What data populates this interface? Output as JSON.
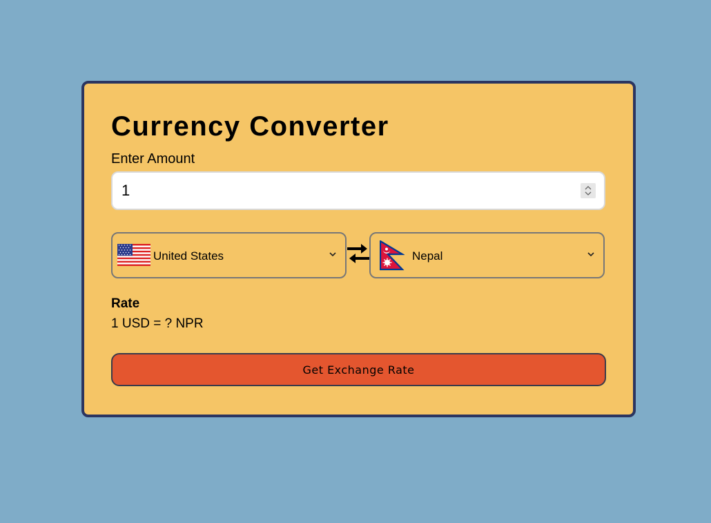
{
  "app": {
    "title": "Currency Converter"
  },
  "amount": {
    "label": "Enter Amount",
    "value": "1"
  },
  "from": {
    "country": "United States",
    "flag_icon": "us-flag-icon"
  },
  "to": {
    "country": "Nepal",
    "flag_icon": "nepal-flag-icon"
  },
  "rate": {
    "heading": "Rate",
    "text": "1 USD = ? NPR"
  },
  "button": {
    "label": "Get Exchange Rate"
  },
  "colors": {
    "background": "#7facc8",
    "card": "#f5c566",
    "card_border": "#2b3560",
    "button": "#e4562f"
  }
}
